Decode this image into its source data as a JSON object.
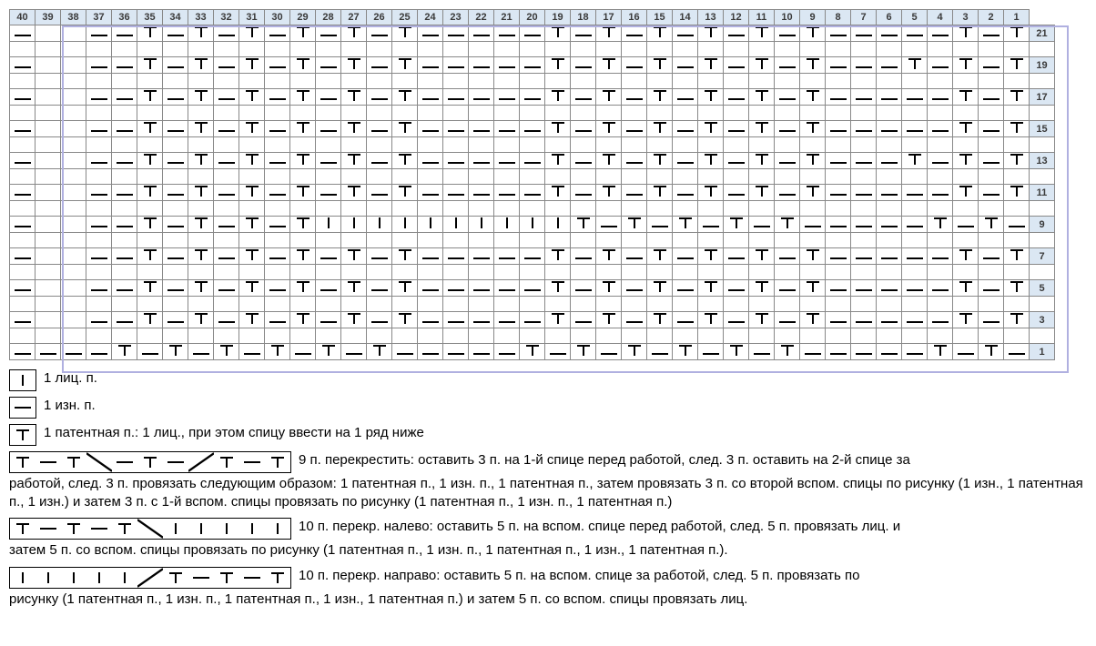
{
  "chart_data": {
    "type": "knitting-chart",
    "columns": 40,
    "column_labels": [
      40,
      39,
      38,
      37,
      36,
      35,
      34,
      33,
      32,
      31,
      30,
      29,
      28,
      27,
      26,
      25,
      24,
      23,
      22,
      21,
      20,
      19,
      18,
      17,
      16,
      15,
      14,
      13,
      12,
      11,
      10,
      9,
      8,
      7,
      6,
      5,
      4,
      3,
      2,
      1
    ],
    "row_labels": [
      21,
      19,
      17,
      15,
      13,
      11,
      9,
      7,
      5,
      3,
      1
    ],
    "rows": [
      "-   - - T - T - T - T - T - T - - - - - T - T - T - T - T - T - - - - - T - T -",
      "-   - - T - T - T - T - T - T - - - - - T - T - T - T - T - T - - - T - T - T -",
      "-   - - T - T - T - T - T - T - - - - - T - T - T - T - T - T - - - - - T - T -",
      "-   - - T - T - T - T - T - T - - - - - T - T - T - T - T - T - - - - - T - T -",
      "-   - - T - T - T - T - T - T - - - - - T - T - T - T - T - T - - - T - T - T -",
      "-   - - T - T - T - T - T - T - - - - - T - T - T - T - T - T - - - - - T - T -",
      "-   - - T - T - T - T I I I I I I I I I I T - T - T - T - T - - - - - T - T -",
      "-   - - T - T - T - T - T - T - - - - - T - T - T - T - T - T - - - - - T - T -",
      "-   - - T - T - T - T - T - T - - - - - T - T - T - T - T - T - - - - - T - T -",
      "-   - - T - T - T - T - T - T - - - - - T - T - T - T - T - T - - - - - T - T -",
      "- - - - T - T - T - T - T - T - - - - - T - T - T - T - T - T - - - - - T - T -"
    ],
    "symbols": {
      "-": "purl",
      "I": "knit",
      "T": "patent"
    },
    "pattern_repeat": {
      "from_col": 1,
      "to_col": 38
    }
  },
  "legend": {
    "items": [
      {
        "symbol_cells": [
          "I"
        ],
        "label": "1 лиц. п."
      },
      {
        "symbol_cells": [
          "-"
        ],
        "label": "1 изн. п."
      },
      {
        "symbol_cells": [
          "T"
        ],
        "label": "1 патентная п.: 1 лиц., при этом спицу ввести на 1 ряд ниже"
      },
      {
        "symbol_cells": [
          "T",
          "-",
          "T",
          "\\",
          "-",
          "T",
          "-",
          "/",
          "T",
          "-",
          "T"
        ],
        "label_first": "9 п. перекрестить: оставить 3 п. на 1-й спице перед работой, след. 3 п. оставить на 2-й спице за",
        "label_rest": "работой, след. 3 п. провязать следующим образом: 1 патентная п., 1 изн. п., 1 патентная п., затем провязать 3 п. со второй вспом. спицы по рисунку (1 изн., 1 патентная п., 1 изн.) и затем 3 п. с 1-й вспом. спицы провязать по рисунку (1 патентная п., 1 изн. п., 1 патентная п.)"
      },
      {
        "symbol_cells": [
          "T",
          "-",
          "T",
          "-",
          "T",
          "\\",
          "I",
          "I",
          "I",
          "I",
          "I"
        ],
        "label_first": "10 п. перекр. налево: оставить 5 п. на вспом. спице перед работой, след. 5 п. провязать лиц. и",
        "label_rest": "затем 5 п. со вспом. спицы провязать по рисунку (1 патентная п., 1 изн. п., 1 патентная п., 1 изн., 1 патентная п.)."
      },
      {
        "symbol_cells": [
          "I",
          "I",
          "I",
          "I",
          "I",
          "/",
          "T",
          "-",
          "T",
          "-",
          "T"
        ],
        "label_first": "10 п. перекр. направо: оставить 5 п. на вспом. спице за работой, след. 5 п. провязать по",
        "label_rest": "рисунку (1 патентная п., 1 изн. п., 1 патентная п., 1 изн., 1 патентная п.) и затем 5 п. со вспом. спицы провязать лиц."
      }
    ]
  }
}
